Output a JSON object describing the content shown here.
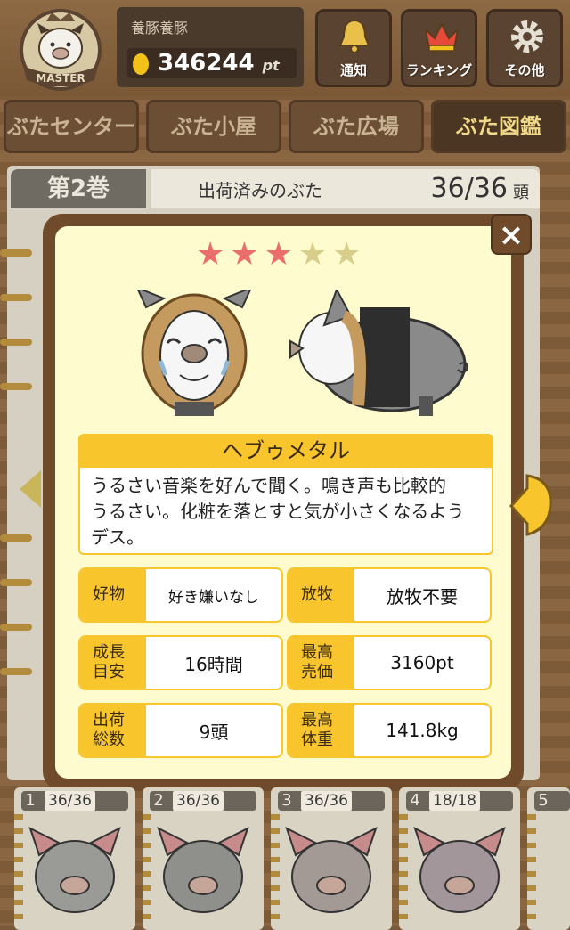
{
  "header": {
    "badge_text": "MASTER",
    "username": "養豚養豚",
    "points": "346244",
    "points_unit": "pt",
    "buttons": [
      {
        "label": "通知",
        "icon": "bell-icon"
      },
      {
        "label": "ランキング",
        "icon": "crown-icon"
      },
      {
        "label": "その他",
        "icon": "gear-icon"
      }
    ]
  },
  "nav": {
    "tabs": [
      {
        "label": "ぶたセンター",
        "active": false
      },
      {
        "label": "ぶた小屋",
        "active": false
      },
      {
        "label": "ぶた広場",
        "active": false
      },
      {
        "label": "ぶた図鑑",
        "active": true
      }
    ]
  },
  "book": {
    "volume": "第2巻",
    "title": "出荷済みのぶた",
    "count": "36/36",
    "count_unit": "頭"
  },
  "modal": {
    "close_label": "×",
    "rating": 3,
    "rating_max": 5,
    "pig_name": "ヘブゥメタル",
    "description_lines": [
      "うるさい音楽を好んで聞く。鳴き声も比較的",
      "うるさい。化粧を落とすと気が小さくなるよう",
      "デス。"
    ],
    "stats": [
      {
        "key": "好物",
        "value": "好き嫌いなし"
      },
      {
        "key": "放牧",
        "value": "放牧不要"
      },
      {
        "key": "成長\n目安",
        "value": "16時間"
      },
      {
        "key": "最高\n売価",
        "value": "3160pt"
      },
      {
        "key": "出荷\n総数",
        "value": "9頭"
      },
      {
        "key": "最高\n体重",
        "value": "141.8kg"
      }
    ]
  },
  "shelf": {
    "cards": [
      {
        "number": "1",
        "count": "36/36"
      },
      {
        "number": "2",
        "count": "36/36"
      },
      {
        "number": "3",
        "count": "36/36"
      },
      {
        "number": "4",
        "count": "18/18"
      },
      {
        "number": "5",
        "count": ""
      }
    ]
  },
  "colors": {
    "accent_yellow": "#f8c52c",
    "panel_cream": "#fefccf",
    "frame_brown": "#6f4a2b",
    "star_on": "#ea6f6b",
    "star_off": "#d8cd8a"
  }
}
